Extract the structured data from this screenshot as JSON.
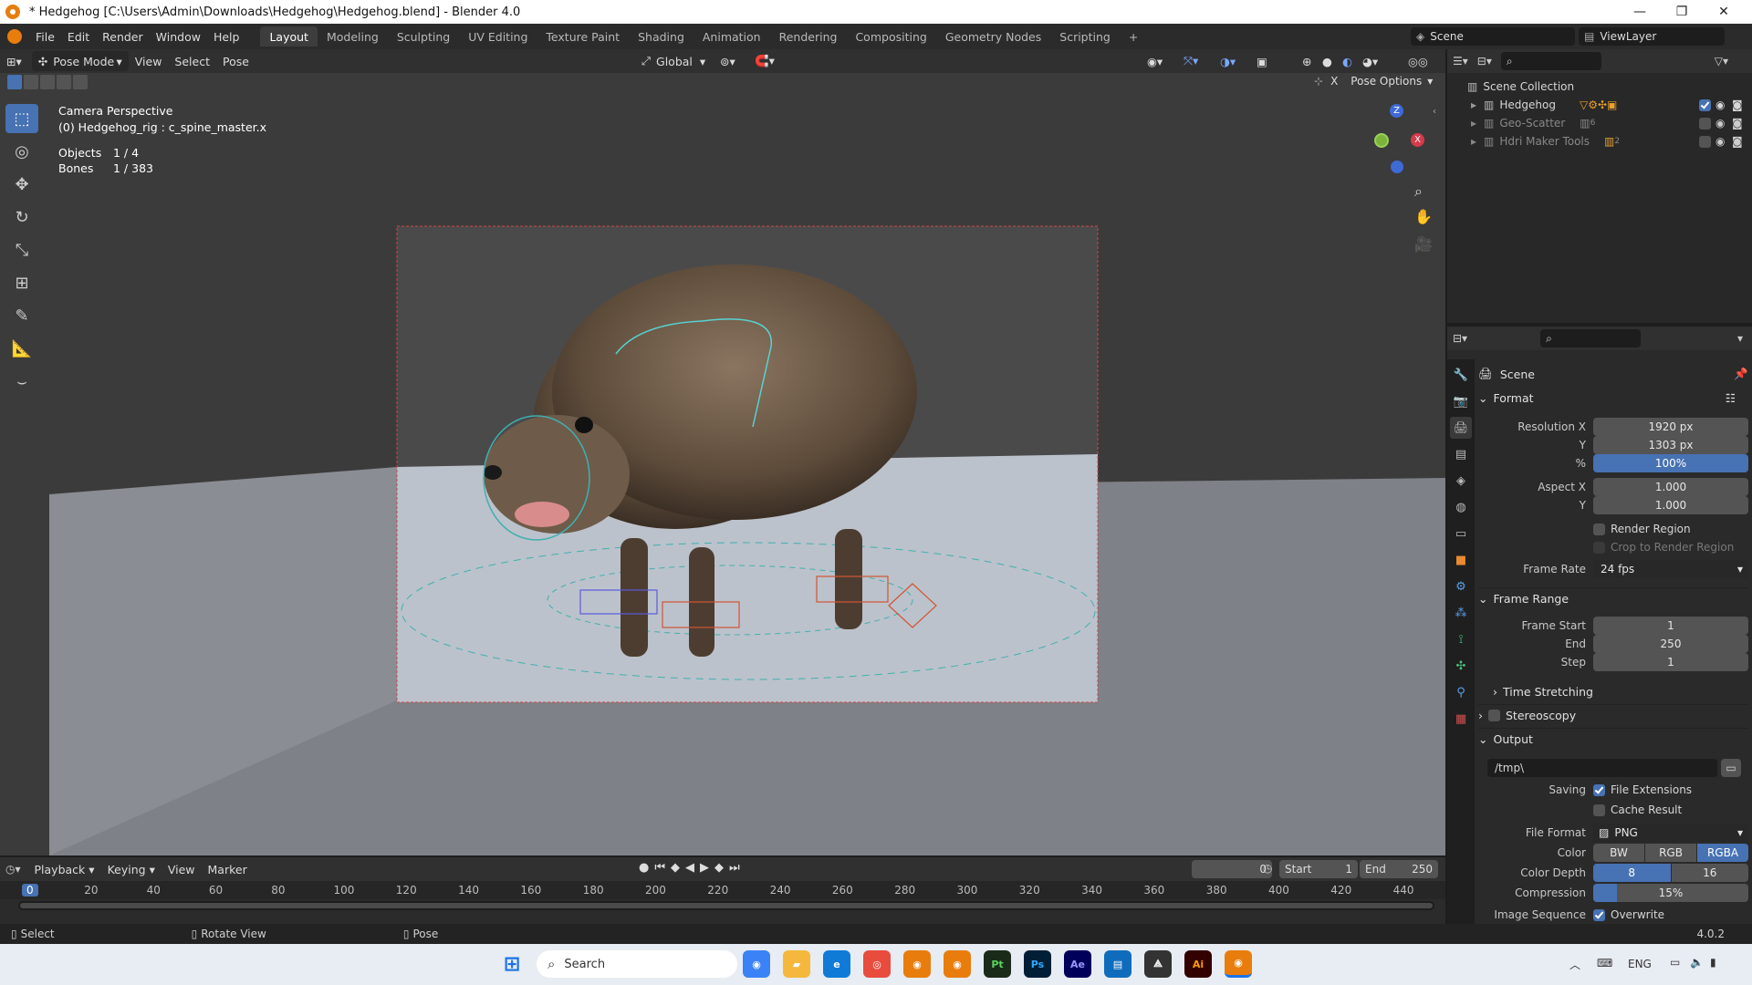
{
  "window": {
    "title": "* Hedgehog [C:\\Users\\Admin\\Downloads\\Hedgehog\\Hedgehog.blend] - Blender 4.0",
    "minimize": "—",
    "maximize": "❐",
    "close": "✕"
  },
  "menubar": {
    "items": [
      "File",
      "Edit",
      "Render",
      "Window",
      "Help"
    ],
    "workspaces": [
      "Layout",
      "Modeling",
      "Sculpting",
      "UV Editing",
      "Texture Paint",
      "Shading",
      "Animation",
      "Rendering",
      "Compositing",
      "Geometry Nodes",
      "Scripting"
    ],
    "add_tab": "+",
    "scene": "Scene",
    "view_layer": "ViewLayer"
  },
  "viewport_header": {
    "mode": "Pose Mode",
    "menus": [
      "View",
      "Select",
      "Pose"
    ],
    "transform_orientation": "Global",
    "pose_options": "Pose Options",
    "x_toggle": "X"
  },
  "viewport": {
    "view_name": "Camera Perspective",
    "active": "(0) Hedgehog_rig : c_spine_master.x",
    "stats": [
      {
        "label": "Objects",
        "value": "1 / 4"
      },
      {
        "label": "Bones",
        "value": "1 / 383"
      }
    ],
    "gizmo_z": "Z",
    "gizmo_x": "X"
  },
  "outliner": {
    "root": "Scene Collection",
    "items": [
      {
        "name": "Hedgehog",
        "enabled": true
      },
      {
        "name": "Geo-Scatter",
        "enabled": false,
        "count": "6"
      },
      {
        "name": "Hdri Maker Tools",
        "enabled": false,
        "count": "2"
      }
    ]
  },
  "properties": {
    "context": "Scene",
    "format": {
      "title": "Format",
      "resolution_x_label": "Resolution X",
      "resolution_x": "1920 px",
      "resolution_y_label": "Y",
      "resolution_y": "1303 px",
      "percent_label": "%",
      "percent": "100%",
      "aspect_x_label": "Aspect X",
      "aspect_x": "1.000",
      "aspect_y_label": "Y",
      "aspect_y": "1.000",
      "render_region": "Render Region",
      "crop": "Crop to Render Region",
      "frame_rate_label": "Frame Rate",
      "frame_rate": "24 fps"
    },
    "frame_range": {
      "title": "Frame Range",
      "start_label": "Frame Start",
      "start": "1",
      "end_label": "End",
      "end": "250",
      "step_label": "Step",
      "step": "1",
      "time_stretching": "Time Stretching"
    },
    "stereoscopy": "Stereoscopy",
    "output": {
      "title": "Output",
      "path": "/tmp\\",
      "saving_label": "Saving",
      "file_extensions": "File Extensions",
      "cache_result": "Cache Result",
      "file_format_label": "File Format",
      "file_format": "PNG",
      "color_label": "Color",
      "color_options": [
        "BW",
        "RGB",
        "RGBA"
      ],
      "color_selected": "RGBA",
      "depth_label": "Color Depth",
      "depth_options": [
        "8",
        "16"
      ],
      "compression_label": "Compression",
      "compression": "15%",
      "compression_fraction": 0.15,
      "image_sequence_label": "Image Sequence",
      "overwrite": "Overwrite"
    }
  },
  "timeline": {
    "menus": [
      "Playback",
      "Keying",
      "View",
      "Marker"
    ],
    "current_frame": "0",
    "start_label": "Start",
    "start": "1",
    "end_label": "End",
    "end": "250",
    "ruler": [
      "0",
      "20",
      "40",
      "60",
      "80",
      "100",
      "120",
      "140",
      "160",
      "180",
      "200",
      "220",
      "240",
      "260",
      "280",
      "300",
      "320",
      "340",
      "360",
      "380",
      "400",
      "420",
      "440"
    ]
  },
  "statusbar": {
    "items": [
      "Select",
      "Rotate View",
      "Pose"
    ],
    "version": "4.0.2"
  },
  "taskbar": {
    "search": "Search",
    "lang": "ENG",
    "apps": [
      {
        "name": "Pt",
        "color": "#1a2b1a",
        "fg": "#5bd45b"
      },
      {
        "name": "Ps",
        "color": "#001e36",
        "fg": "#31a8ff"
      },
      {
        "name": "Ae",
        "color": "#00005b",
        "fg": "#9999ff"
      },
      {
        "name": "Ai",
        "color": "#330000",
        "fg": "#ff9a00"
      }
    ]
  }
}
